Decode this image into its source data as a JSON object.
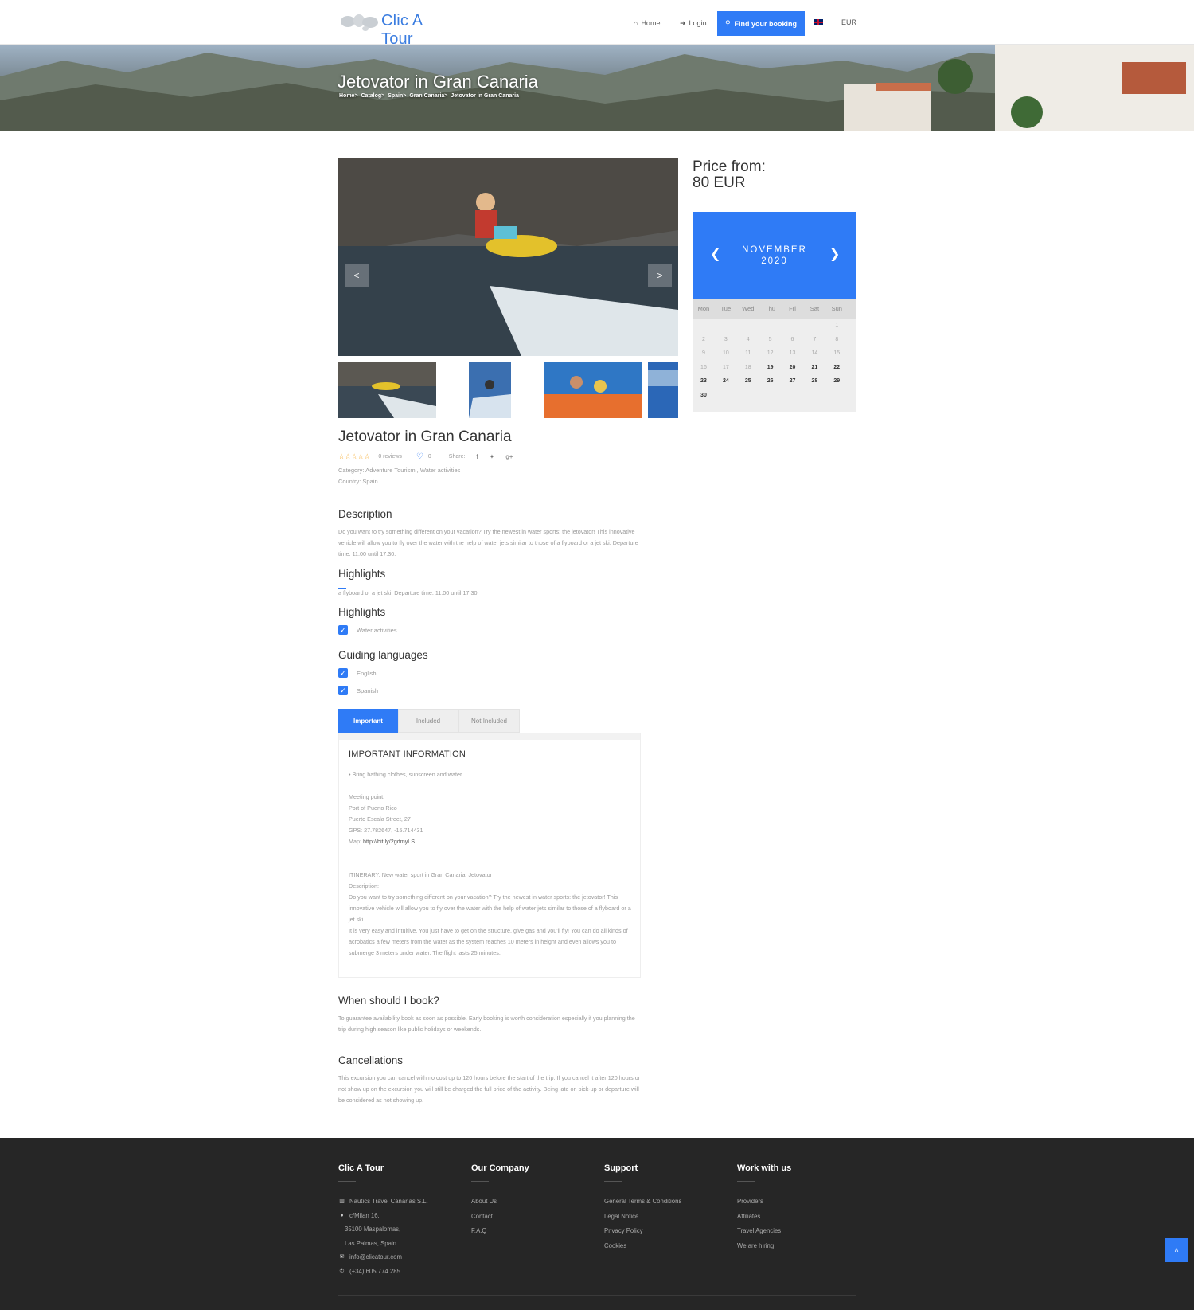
{
  "header": {
    "logo_text": "Clic A Tour",
    "nav": {
      "home": "Home",
      "login": "Login",
      "find_booking": "Find your booking",
      "currency": "EUR"
    }
  },
  "hero": {
    "title": "Jetovator in Gran Canaria",
    "breadcrumb": [
      "Home",
      "Catalog",
      "Spain",
      "Gran Canaria",
      "Jetovator in Gran Canaria"
    ],
    "breadcrumb_separator": ">"
  },
  "gallery": {
    "prev_label": "<",
    "next_label": ">"
  },
  "tour": {
    "title": "Jetovator in Gran Canaria",
    "stars_display": "☆☆☆☆☆",
    "rating": 0,
    "reviews_label": "0 reviews",
    "likes": "0",
    "share_label": "Share:",
    "category": "Category: Adventure Tourism , Water activities",
    "country": "Country: Spain"
  },
  "description": {
    "heading": "Description",
    "text": "Do you want to try something different on your vacation? Try the newest in water sports: the jetovator! This innovative vehicle will allow you to fly over the water with the help of water jets similar to those of a flyboard or a jet ski. Departure time: 11:00 until 17:30."
  },
  "highlights": {
    "heading": "Highlights",
    "text": "a flyboard or a jet ski. Departure time: 11:00 until 17:30."
  },
  "highlights_list": {
    "heading": "Highlights",
    "items": [
      "Water activities"
    ]
  },
  "languages": {
    "heading": "Guiding languages",
    "items": [
      "English",
      "Spanish"
    ]
  },
  "tabs": {
    "items": [
      "Important",
      "Included",
      "Not Included"
    ],
    "active": "Important"
  },
  "important": {
    "title": "IMPORTANT INFORMATION",
    "bullet": "Bring bathing clothes, sunscreen and water.",
    "meeting_label": "Meeting point:",
    "meeting_place": "Port of Puerto Rico",
    "meeting_address": "Puerto Escala Street, 27",
    "gps": "GPS: 27.782647, -15.714431",
    "map_label": "Map:",
    "map_link": "http://bit.ly/2gdmyLS",
    "itinerary": "ITINERARY: New water sport in Gran Canaria: Jetovator",
    "desc_label": "Description:",
    "desc_text_1": "Do you want to try something different on your vacation? Try the newest in water sports: the jetovator! This innovative vehicle will allow you to fly over the water with the help of water jets similar to those of a flyboard or a jet ski.",
    "desc_text_2": "It is very easy and intuitive. You just have to get on the structure, give gas and you'll fly! You can do all kinds of acrobatics a few meters from the water as the system reaches 10 meters in height and even allows you to submerge 3 meters under water. The flight lasts 25 minutes."
  },
  "when_book": {
    "heading": "When should I book?",
    "text": "To guarantee availability book as soon as possible. Early booking is worth consideration especially if you planning the trip during high season like public holidays or weekends."
  },
  "cancellations": {
    "heading": "Cancellations",
    "text": "This excursion you can cancel with no cost up to 120 hours before the start of the trip. If you cancel it after 120 hours or not show up on the excursion you will still be charged the full price of the activity. Being late on pick-up or departure will be considered as not showing up."
  },
  "price": {
    "label": "Price from:",
    "value": "80 EUR"
  },
  "calendar": {
    "month": "NOVEMBER",
    "year": "2020",
    "prev": "❮",
    "next": "❯",
    "weekdays": [
      "Mon",
      "Tue",
      "Wed",
      "Thu",
      "Fri",
      "Sat",
      "Sun"
    ],
    "weeks": [
      [
        "",
        "",
        "",
        "",
        "",
        "",
        "1"
      ],
      [
        "2",
        "3",
        "4",
        "5",
        "6",
        "7",
        "8"
      ],
      [
        "9",
        "10",
        "11",
        "12",
        "13",
        "14",
        "15"
      ],
      [
        "16",
        "17",
        "18",
        "19",
        "20",
        "21",
        "22"
      ],
      [
        "23",
        "24",
        "25",
        "26",
        "27",
        "28",
        "29"
      ],
      [
        "30",
        "",
        "",
        "",
        "",
        "",
        ""
      ]
    ],
    "available_days": [
      "19",
      "20",
      "21",
      "22",
      "23",
      "24",
      "25",
      "26",
      "27",
      "28",
      "29",
      "30"
    ]
  },
  "footer": {
    "col1": {
      "heading": "Clic A Tour",
      "company": "Nautics Travel Canarias S.L.",
      "address1": "c/Milan 16,",
      "address2": "35100 Maspalomas,",
      "address3": "Las Palmas, Spain",
      "email": "info@clicatour.com",
      "phone": "(+34) 605 774 285"
    },
    "col2": {
      "heading": "Our Company",
      "links": [
        "About Us",
        "Contact",
        "F.A.Q"
      ]
    },
    "col3": {
      "heading": "Support",
      "links": [
        "General Terms & Conditions",
        "Legal Notice",
        "Privacy Policy",
        "Cookies"
      ]
    },
    "col4": {
      "heading": "Work with us",
      "links": [
        "Providers",
        "Affiliates",
        "Travel Agencies",
        "We are hiring"
      ]
    }
  },
  "colors": {
    "accent": "#2f7bf6",
    "footer_bg": "#262626",
    "text_muted": "#999999"
  }
}
